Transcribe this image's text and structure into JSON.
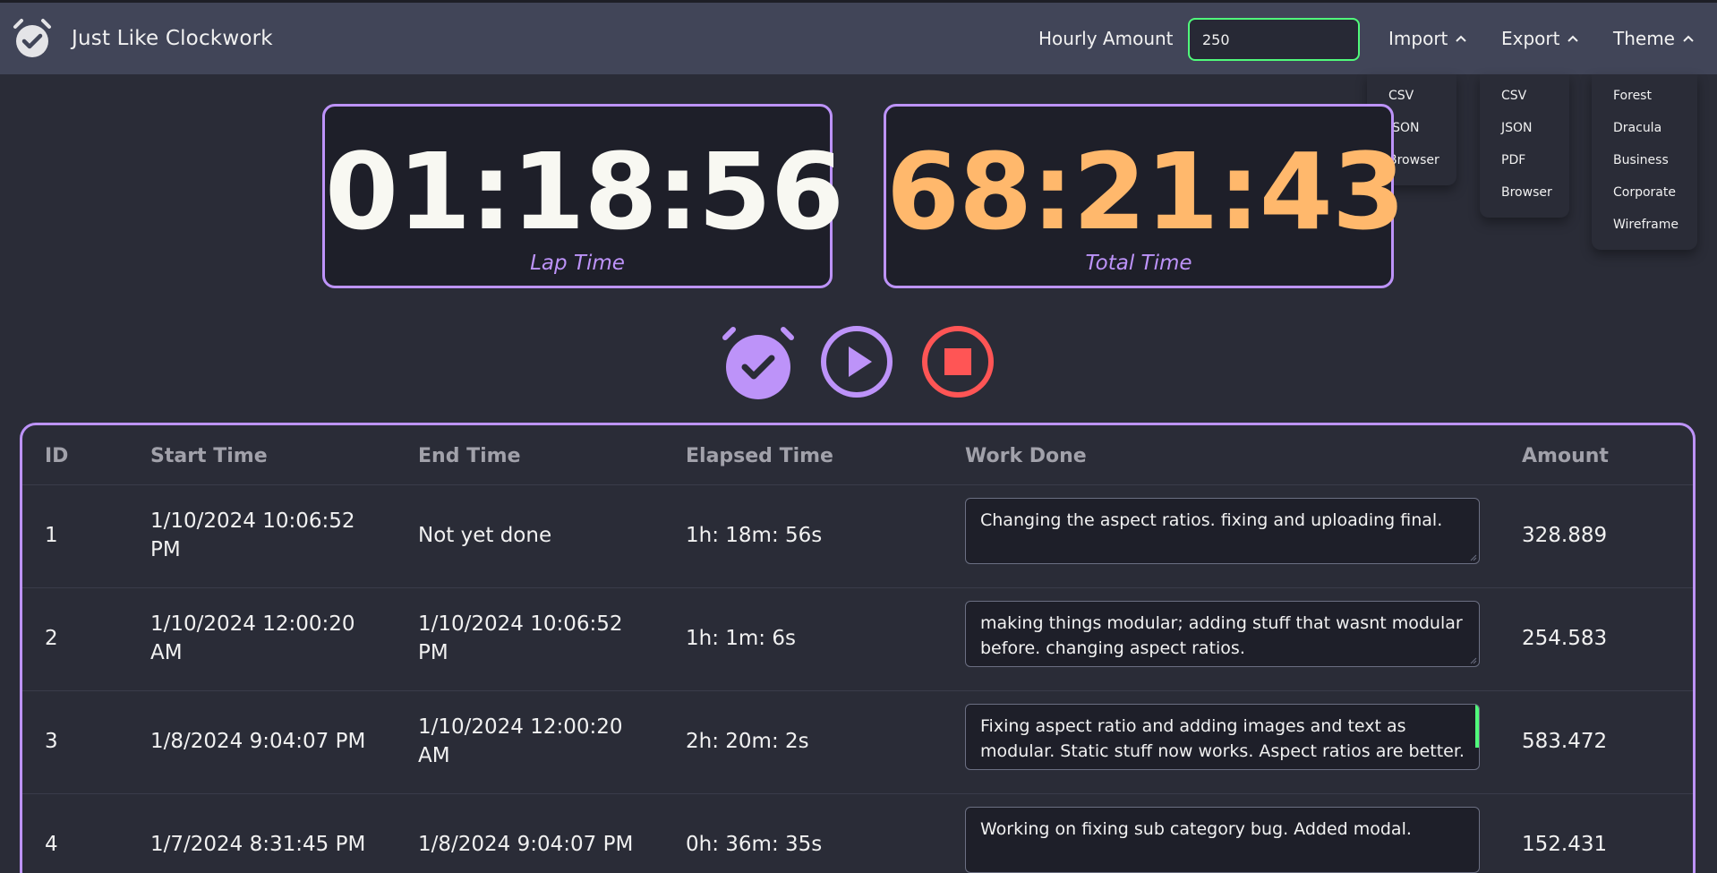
{
  "app": {
    "title": "Just Like Clockwork"
  },
  "header": {
    "hourly_label": "Hourly Amount",
    "hourly_value": "250",
    "import_label": "Import",
    "export_label": "Export",
    "theme_label": "Theme"
  },
  "menus": {
    "import": [
      "CSV",
      "JSON",
      "Browser"
    ],
    "export": [
      "CSV",
      "JSON",
      "PDF",
      "Browser"
    ],
    "theme": [
      "Forest",
      "Dracula",
      "Business",
      "Corporate",
      "Wireframe"
    ]
  },
  "timers": {
    "lap": {
      "value": "01:18:56",
      "label": "Lap Time"
    },
    "total": {
      "value": "68:21:43",
      "label": "Total Time"
    }
  },
  "controls": {
    "icons": [
      "alarm-check-icon",
      "play-icon",
      "stop-icon"
    ]
  },
  "table": {
    "headers": [
      "ID",
      "Start Time",
      "End Time",
      "Elapsed Time",
      "Work Done",
      "Amount"
    ],
    "rows": [
      {
        "id": "1",
        "start": [
          "1/10/2024 10:06:52",
          "PM"
        ],
        "end": [
          "Not yet done",
          ""
        ],
        "elapsed": "1h: 18m: 56s",
        "work": "Changing the aspect ratios. fixing and uploading final.",
        "amount": "328.889"
      },
      {
        "id": "2",
        "start": [
          "1/10/2024 12:00:20",
          "AM"
        ],
        "end": [
          "1/10/2024 10:06:52",
          "PM"
        ],
        "elapsed": "1h: 1m: 6s",
        "work": "making things modular; adding stuff that wasnt modular before. changing aspect ratios.",
        "amount": "254.583"
      },
      {
        "id": "3",
        "start": [
          "1/8/2024 9:04:07 PM",
          ""
        ],
        "end": [
          "1/10/2024 12:00:20",
          "AM"
        ],
        "elapsed": "2h: 20m: 2s",
        "work": "Fixing aspect ratio and adding images and text as modular. Static stuff now works. Aspect ratios are better. Making",
        "amount": "583.472"
      },
      {
        "id": "4",
        "start": [
          "1/7/2024 8:31:45 PM",
          ""
        ],
        "end": [
          "1/8/2024 9:04:07 PM",
          ""
        ],
        "elapsed": "0h: 36m: 35s",
        "work": "Working on fixing sub category bug. Added modal.",
        "amount": "152.431"
      }
    ]
  },
  "colors": {
    "accent": "#bd93f9",
    "total_time": "#ffb86c",
    "stop": "#ff5555",
    "input_border": "#50fa7b",
    "topbar": "#414558",
    "background": "#2a2c37"
  }
}
